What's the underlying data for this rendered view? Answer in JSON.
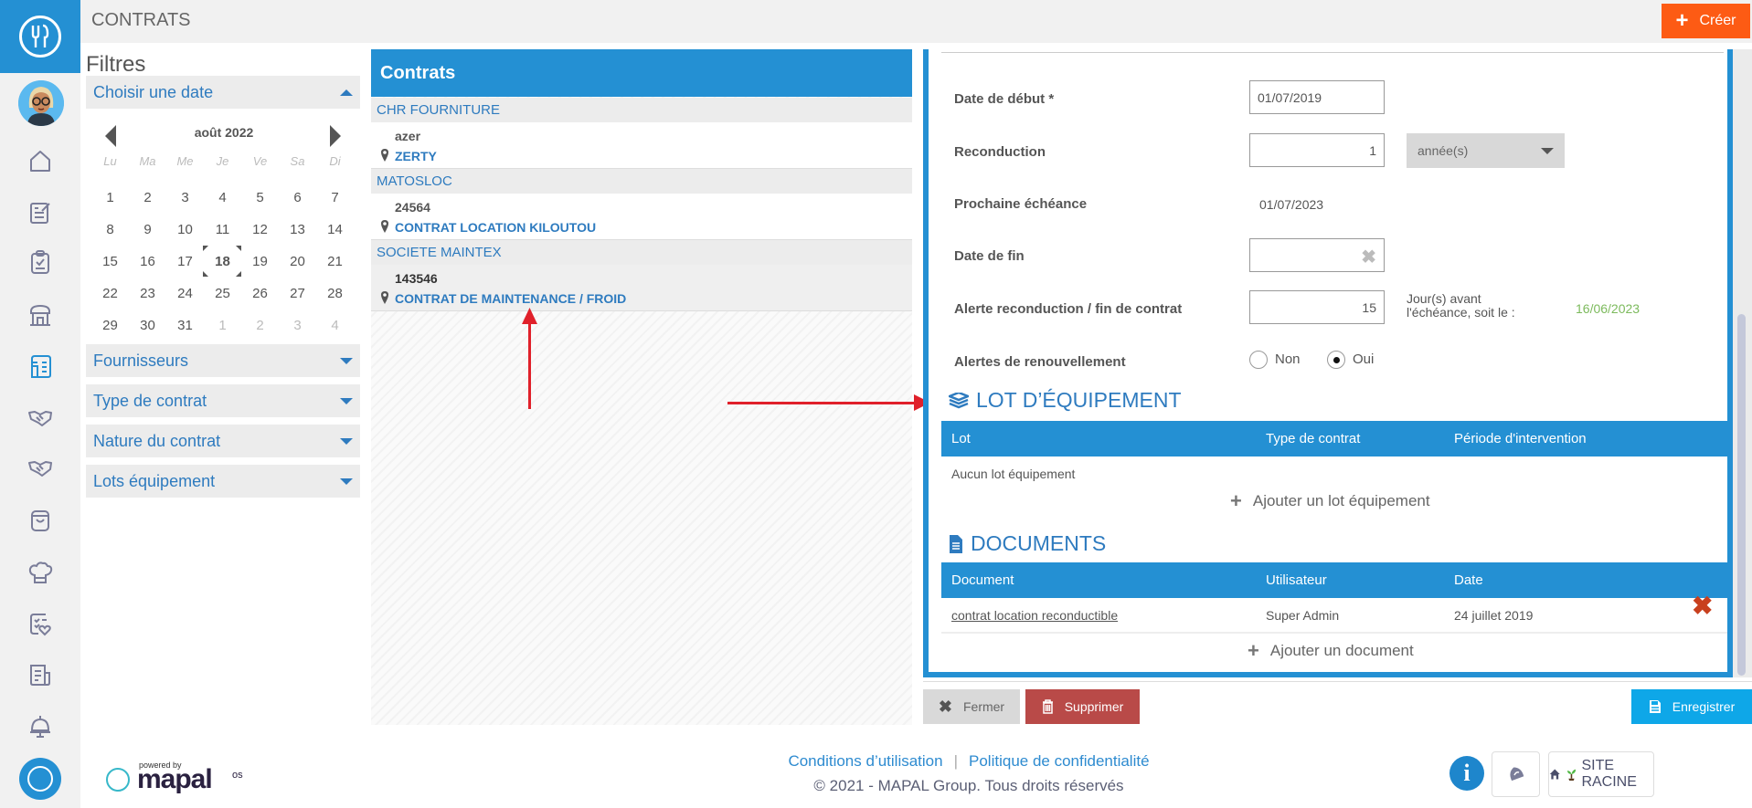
{
  "app": {
    "page_title": "CONTRATS",
    "create_label": "Créer"
  },
  "nav": {
    "items": [
      {
        "name": "home-icon",
        "active": false
      },
      {
        "name": "edit-document-icon",
        "active": false
      },
      {
        "name": "clipboard-check-icon",
        "active": false
      },
      {
        "name": "store-icon",
        "active": false
      },
      {
        "name": "equipment-icon",
        "active": true
      },
      {
        "name": "handshake-icon",
        "active": false
      },
      {
        "name": "handshake-alt-icon",
        "active": false
      },
      {
        "name": "shopping-bag-icon",
        "active": false
      },
      {
        "name": "chef-hat-icon",
        "active": false
      },
      {
        "name": "checklist-heart-icon",
        "active": false
      },
      {
        "name": "report-icon",
        "active": false
      },
      {
        "name": "cloche-icon",
        "active": false
      }
    ]
  },
  "filters": {
    "title": "Filtres",
    "date_section": "Choisir une date",
    "calendar": {
      "month": "août 2022",
      "day_names": [
        "Lu",
        "Ma",
        "Me",
        "Je",
        "Ve",
        "Sa",
        "Di"
      ],
      "weeks": [
        [
          "1",
          "2",
          "3",
          "4",
          "5",
          "6",
          "7"
        ],
        [
          "8",
          "9",
          "10",
          "11",
          "12",
          "13",
          "14"
        ],
        [
          "15",
          "16",
          "17",
          "18",
          "19",
          "20",
          "21"
        ],
        [
          "22",
          "23",
          "24",
          "25",
          "26",
          "27",
          "28"
        ],
        [
          "29",
          "30",
          "31",
          "1",
          "2",
          "3",
          "4"
        ]
      ],
      "selected_day": "18"
    },
    "sections": [
      "Fournisseurs",
      "Type de contrat",
      "Nature du contrat",
      "Lots équipement"
    ]
  },
  "contracts": {
    "header": "Contrats",
    "groups": [
      {
        "supplier": "CHR FOURNITURE",
        "items": [
          {
            "number": "azer",
            "name": "ZERTY",
            "active": false
          }
        ]
      },
      {
        "supplier": "MATOSLOC",
        "items": [
          {
            "number": "24564",
            "name": "CONTRAT LOCATION KILOUTOU",
            "active": false
          }
        ]
      },
      {
        "supplier": "SOCIETE MAINTEX",
        "items": [
          {
            "number": "143546",
            "name": "CONTRAT DE MAINTENANCE / FROID",
            "active": true
          }
        ]
      }
    ]
  },
  "detail": {
    "start_date_label": "Date de début *",
    "start_date_value": "01/07/2019",
    "reconduction_label": "Reconduction",
    "reconduction_value": "1",
    "reconduction_unit": "année(s)",
    "next_due_label": "Prochaine échéance",
    "next_due_value": "01/07/2023",
    "end_date_label": "Date de fin",
    "end_date_value": "",
    "alert_label": "Alerte reconduction / fin de contrat",
    "alert_value": "15",
    "alert_text_line1": "Jour(s) avant",
    "alert_text_line2": "l'échéance, soit le :",
    "alert_date": "16/06/2023",
    "renewal_label": "Alertes de renouvellement",
    "renewal_options": [
      "Non",
      "Oui"
    ],
    "renewal_selected": "Oui",
    "equipment": {
      "title": "LOT D’ÉQUIPEMENT",
      "columns": [
        "Lot",
        "Type de contrat",
        "Période d'intervention"
      ],
      "empty": "Aucun lot équipement",
      "add_label": "Ajouter un lot équipement"
    },
    "documents": {
      "title": "DOCUMENTS",
      "columns": [
        "Document",
        "Utilisateur",
        "Date"
      ],
      "rows": [
        {
          "document": "contrat location reconductible",
          "user": "Super Admin",
          "date": "24 juillet 2019"
        }
      ],
      "add_label": "Ajouter un document"
    }
  },
  "actions": {
    "close": "Fermer",
    "delete": "Supprimer",
    "save": "Enregistrer"
  },
  "footer": {
    "powered_by": "powered by",
    "brand": "mapal",
    "brand_suffix": "os",
    "terms": "Conditions d’utilisation",
    "separator": "|",
    "privacy": "Politique de confidentialité",
    "copyright": "© 2021 - MAPAL Group. Tous droits réservés",
    "site_button": "SITE RACINE"
  },
  "colors": {
    "primary": "#2490d3",
    "create": "#fd5b14",
    "delete": "#b94a48",
    "save": "#0ea7e8",
    "alert_date": "#7cba5c",
    "annotation_arrow": "#e0202a"
  }
}
